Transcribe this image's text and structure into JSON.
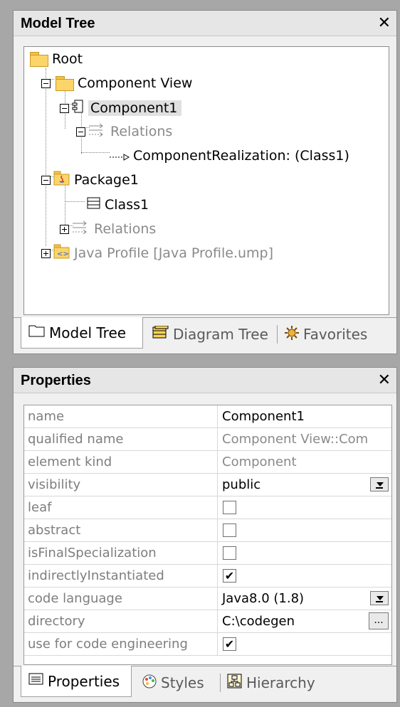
{
  "model_tree": {
    "title": "Model Tree",
    "close_glyph": "✕",
    "items": [
      {
        "label": "Root",
        "icon": "folder-icon"
      },
      {
        "label": "Component View",
        "icon": "folder-icon"
      },
      {
        "label": "Component1",
        "icon": "component-icon"
      },
      {
        "label": "Relations",
        "icon": "relations-icon"
      },
      {
        "label": "ComponentRealization:  (Class1)",
        "icon": "realization-arrow-icon"
      },
      {
        "label": "Package1",
        "icon": "java-package-icon"
      },
      {
        "label": "Class1",
        "icon": "class-icon"
      },
      {
        "label": "Relations",
        "icon": "relations-icon"
      },
      {
        "label": "Java Profile [Java Profile.ump]",
        "icon": "profile-package-icon"
      }
    ],
    "tabs": [
      {
        "label": "Model Tree",
        "icon": "folder-icon",
        "active": true
      },
      {
        "label": "Diagram Tree",
        "icon": "diagram-tree-icon",
        "active": false
      },
      {
        "label": "Favorites",
        "icon": "favorites-icon",
        "active": false
      }
    ]
  },
  "properties": {
    "title": "Properties",
    "close_glyph": "✕",
    "rows": [
      {
        "name": "name",
        "value": "Component1"
      },
      {
        "name": "qualified name",
        "value": "Component View::Com"
      },
      {
        "name": "element kind",
        "value": "Component"
      },
      {
        "name": "visibility",
        "value": "public"
      },
      {
        "name": "leaf",
        "value": ""
      },
      {
        "name": "abstract",
        "value": ""
      },
      {
        "name": "isFinalSpecialization",
        "value": ""
      },
      {
        "name": "indirectlyInstantiated",
        "value": "✔"
      },
      {
        "name": "code language",
        "value": "Java8.0 (1.8)"
      },
      {
        "name": "directory",
        "value": "C:\\codegen"
      },
      {
        "name": "use for code engineering",
        "value": "✔"
      }
    ],
    "ellipsis": "...",
    "tabs": [
      {
        "label": "Properties",
        "icon": "properties-icon",
        "active": true
      },
      {
        "label": "Styles",
        "icon": "styles-palette-icon",
        "active": false
      },
      {
        "label": "Hierarchy",
        "icon": "hierarchy-icon",
        "active": false
      }
    ]
  }
}
